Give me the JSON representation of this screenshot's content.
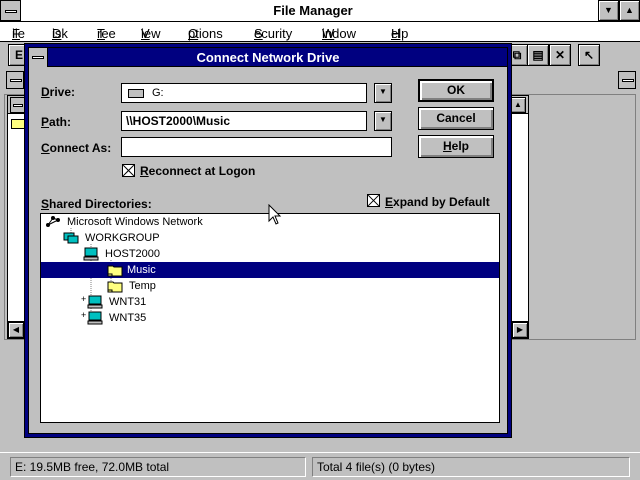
{
  "app": {
    "title": "File Manager"
  },
  "menu": [
    {
      "label": "File",
      "accel": "F",
      "rest": "ile"
    },
    {
      "label": "Disk",
      "accel": "D",
      "rest": "isk"
    },
    {
      "label": "Tree",
      "accel": "T",
      "rest": "ree"
    },
    {
      "label": "View",
      "accel": "V",
      "rest": "iew"
    },
    {
      "label": "Options",
      "accel": "O",
      "rest": "ptions"
    },
    {
      "label": "Security",
      "accel": "S",
      "rest": "ecurity"
    },
    {
      "label": "Window",
      "accel": "W",
      "rest": "indow"
    },
    {
      "label": "Help",
      "accel": "H",
      "rest": "elp"
    }
  ],
  "dialog": {
    "title": "Connect Network Drive",
    "drive_label": {
      "accel": "D",
      "rest": "rive:"
    },
    "drive_value": "G:",
    "path_label": {
      "accel": "P",
      "rest": "ath:"
    },
    "path_value": "\\\\HOST2000\\Music",
    "connect_as_label": {
      "accel": "C",
      "rest": "onnect As:"
    },
    "connect_as_value": "",
    "reconnect_label": {
      "accel": "R",
      "rest": "econnect at Logon"
    },
    "reconnect_checked": true,
    "shared_label": {
      "accel": "S",
      "rest": "hared Directories:"
    },
    "expand_label": {
      "accel": "E",
      "rest": "xpand by Default"
    },
    "expand_checked": true,
    "ok_label": "OK",
    "cancel_label": "Cancel",
    "help_label": {
      "accel": "H",
      "rest": "elp"
    },
    "tree": [
      {
        "label": "Microsoft Windows Network",
        "icon": "network-icon",
        "level": 0,
        "selected": false
      },
      {
        "label": "WORKGROUP",
        "icon": "workgroup-icon",
        "level": 1,
        "selected": false
      },
      {
        "label": "HOST2000",
        "icon": "computer-icon",
        "level": 2,
        "selected": false
      },
      {
        "label": "Music",
        "icon": "shared-folder-icon",
        "level": 3,
        "selected": true
      },
      {
        "label": "Temp",
        "icon": "shared-folder-icon",
        "level": 3,
        "selected": false
      },
      {
        "label": "WNT31",
        "icon": "computer-icon",
        "level": 2,
        "selected": false
      },
      {
        "label": "WNT35",
        "icon": "computer-icon",
        "level": 2,
        "selected": false
      }
    ]
  },
  "status": {
    "left": "E: 19.5MB free,  72.0MB total",
    "right": "Total 4 file(s) (0 bytes)"
  }
}
